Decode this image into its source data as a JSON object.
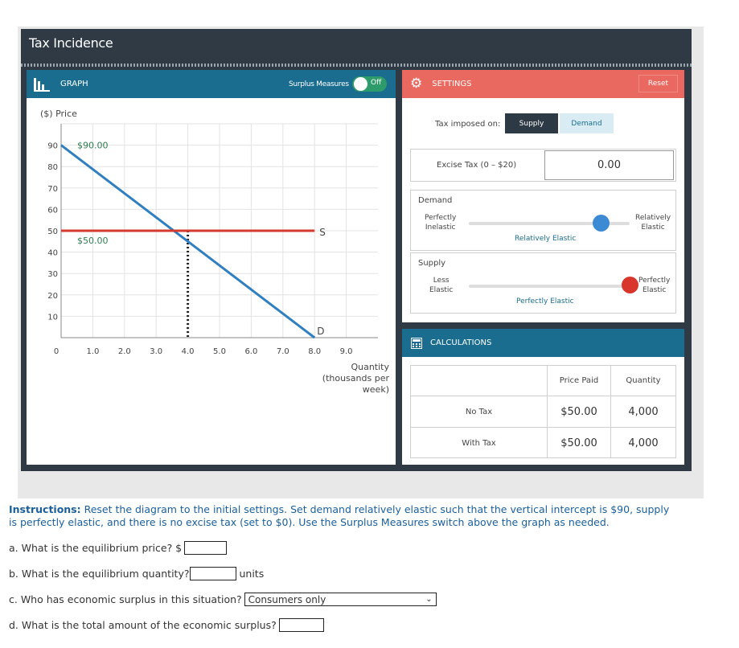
{
  "app": {
    "title": "Tax Incidence"
  },
  "graph": {
    "header": "GRAPH",
    "surplus_label": "Surplus Measures",
    "surplus_state": "Off",
    "y_axis_title": "($) Price",
    "x_axis_title_1": "Quantity",
    "x_axis_title_2": "(thousands per week)",
    "intercept_label": "$90.00",
    "eq_price_label": "$50.00",
    "supply_label": "S",
    "demand_label": "D",
    "colors": {
      "supply": "#d63a2f",
      "demand": "#2f7fc1",
      "dotted": "#222"
    }
  },
  "chart_data": {
    "type": "line",
    "xlim": [
      0,
      10
    ],
    "ylim": [
      0,
      100
    ],
    "x_ticks": [
      0,
      1.0,
      2.0,
      3.0,
      4.0,
      5.0,
      6.0,
      7.0,
      8.0,
      9.0
    ],
    "x_tick_labels": [
      "0",
      "1.0",
      "2.0",
      "3.0",
      "4.0",
      "5.0",
      "6.0",
      "7.0",
      "8.0",
      "9.0"
    ],
    "y_ticks": [
      10,
      20,
      30,
      40,
      50,
      60,
      70,
      80,
      90
    ],
    "y_tick_labels": [
      "10",
      "20",
      "30",
      "40",
      "50",
      "60",
      "70",
      "80",
      "90"
    ],
    "series": [
      {
        "name": "S",
        "x": [
          0,
          8.0
        ],
        "y": [
          50,
          50
        ]
      },
      {
        "name": "D",
        "x": [
          0,
          8.0
        ],
        "y": [
          90,
          0
        ]
      }
    ],
    "equilibrium": {
      "x": 4.0,
      "y": 50
    }
  },
  "settings": {
    "header": "SETTINGS",
    "reset_label": "Reset",
    "tax_on_label": "Tax imposed on:",
    "supply_btn": "Supply",
    "demand_btn": "Demand",
    "excise_label": "Excise Tax (0 – $20)",
    "excise_value": "0.00",
    "demand_title": "Demand",
    "demand_left": "Perfectly\nInelastic",
    "demand_right": "Relatively\nElastic",
    "demand_caption": "Relatively Elastic",
    "demand_level": 0.82,
    "supply_title": "Supply",
    "supply_left": "Less\nElastic",
    "supply_right": "Perfectly\nElastic",
    "supply_caption": "Perfectly Elastic",
    "supply_level": 1.0
  },
  "calculations": {
    "header": "CALCULATIONS",
    "col_price": "Price Paid",
    "col_qty": "Quantity",
    "rows": [
      {
        "label": "No Tax",
        "price": "$50.00",
        "qty": "4,000"
      },
      {
        "label": "With Tax",
        "price": "$50.00",
        "qty": "4,000"
      }
    ]
  },
  "instructions": {
    "lead": "Instructions:",
    "text": " Reset the diagram to the initial settings. Set demand relatively elastic such that the vertical intercept is $90, supply is perfectly elastic, and there is no excise tax (set to $0).  Use the Surplus Measures switch above the graph as needed."
  },
  "questions": {
    "a": "a. What is the equilibrium price? $",
    "b": "b. What is the equilibrium quantity?",
    "b_units": "units",
    "c": "c. Who has economic surplus in this situation?",
    "c_value": "Consumers only",
    "d": "d. What is the total amount of the economic surplus?"
  }
}
